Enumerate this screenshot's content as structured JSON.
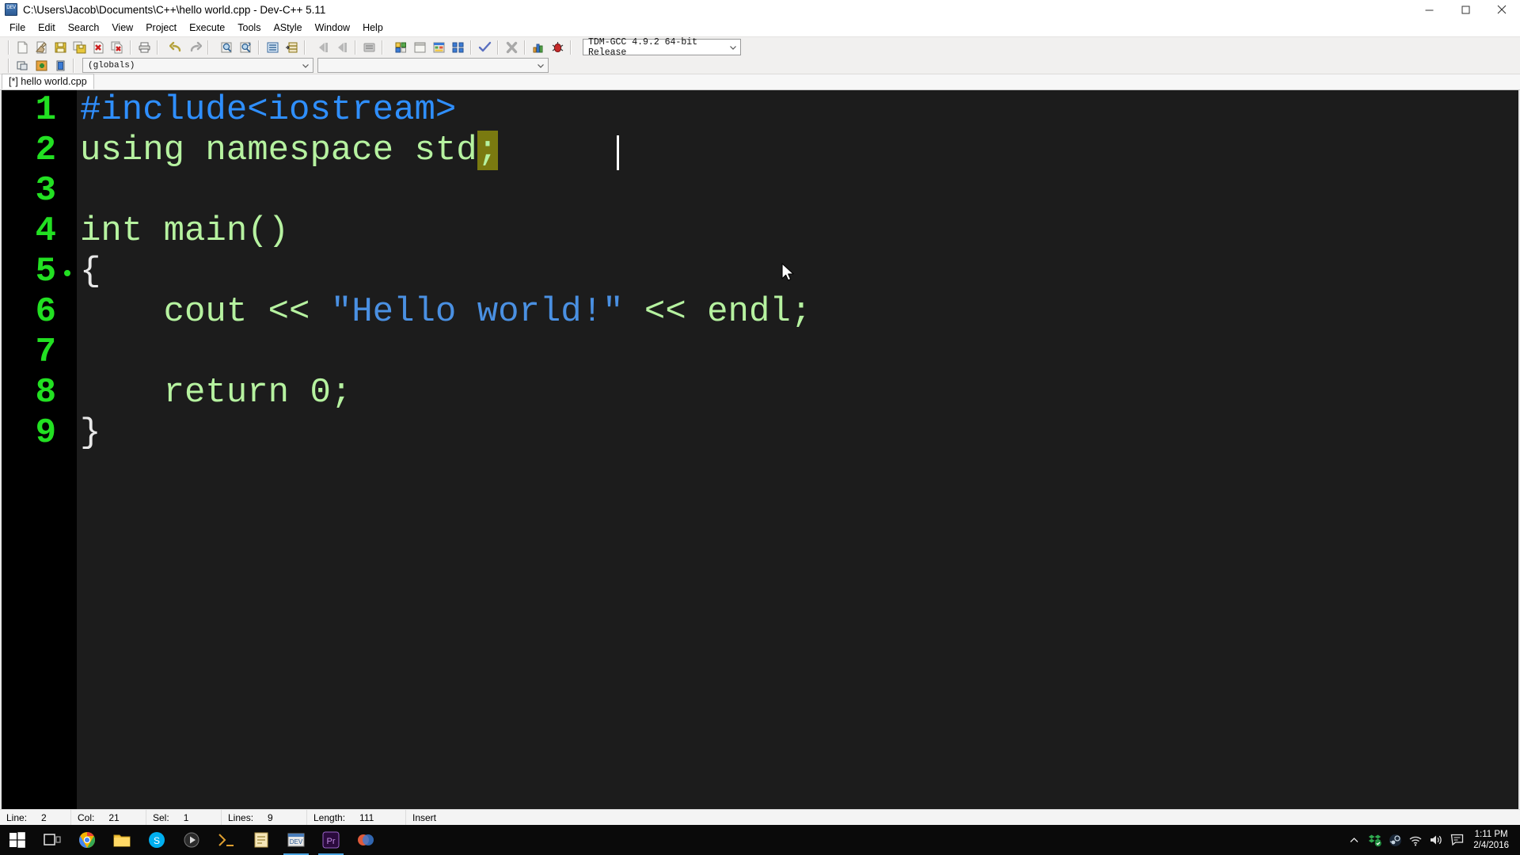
{
  "window": {
    "title": "C:\\Users\\Jacob\\Documents\\C++\\hello world.cpp - Dev-C++ 5.11",
    "app_icon": "dev-cpp-icon",
    "minimize": "—",
    "maximize": "❐",
    "close": "✕"
  },
  "menu": {
    "items": [
      {
        "label": "File"
      },
      {
        "label": "Edit"
      },
      {
        "label": "Search"
      },
      {
        "label": "View"
      },
      {
        "label": "Project"
      },
      {
        "label": "Execute"
      },
      {
        "label": "Tools"
      },
      {
        "label": "AStyle"
      },
      {
        "label": "Window"
      },
      {
        "label": "Help"
      }
    ]
  },
  "toolbar": {
    "groups": [
      {
        "buttons": [
          {
            "name": "new-file-button",
            "icon": "new-file-icon",
            "enabled": true
          },
          {
            "name": "open-file-button",
            "icon": "open-file-icon",
            "enabled": true
          },
          {
            "name": "save-button",
            "icon": "save-icon",
            "enabled": true
          },
          {
            "name": "save-all-button",
            "icon": "save-all-icon",
            "enabled": true
          },
          {
            "name": "close-file-button",
            "icon": "close-file-icon",
            "enabled": true
          },
          {
            "name": "close-all-button",
            "icon": "close-all-icon",
            "enabled": true
          }
        ]
      },
      {
        "buttons": [
          {
            "name": "print-button",
            "icon": "print-icon",
            "enabled": true
          }
        ]
      },
      {
        "buttons": [
          {
            "name": "undo-button",
            "icon": "undo-icon",
            "enabled": true
          },
          {
            "name": "redo-button",
            "icon": "redo-icon",
            "enabled": false
          }
        ]
      },
      {
        "buttons": [
          {
            "name": "find-button",
            "icon": "find-icon",
            "enabled": true
          },
          {
            "name": "replace-button",
            "icon": "replace-icon",
            "enabled": true
          },
          {
            "name": "goto-line-button",
            "icon": "goto-line-icon",
            "enabled": true
          },
          {
            "name": "goto-function-button",
            "icon": "goto-function-icon",
            "enabled": true
          }
        ]
      },
      {
        "buttons": [
          {
            "name": "back-button",
            "icon": "back-arrow-icon",
            "enabled": false
          },
          {
            "name": "forward-button",
            "icon": "forward-arrow-icon",
            "enabled": false
          },
          {
            "name": "toggle-bookmark-button",
            "icon": "bookmark-icon",
            "enabled": false
          }
        ]
      },
      {
        "buttons": [
          {
            "name": "new-project-button",
            "icon": "new-project-icon",
            "enabled": true
          },
          {
            "name": "new-source-file-button",
            "icon": "new-source-icon",
            "enabled": true
          },
          {
            "name": "project-options-button",
            "icon": "project-options-icon",
            "enabled": true
          },
          {
            "name": "compiler-options-button",
            "icon": "compiler-options-icon",
            "enabled": true
          }
        ]
      },
      {
        "buttons": [
          {
            "name": "compile-button",
            "icon": "compile-check-icon",
            "enabled": true
          }
        ]
      },
      {
        "buttons": [
          {
            "name": "abort-compilation-button",
            "icon": "abort-icon",
            "enabled": false
          }
        ]
      },
      {
        "buttons": [
          {
            "name": "profile-analysis-button",
            "icon": "bar-chart-icon",
            "enabled": true
          },
          {
            "name": "debug-button",
            "icon": "debug-bug-icon",
            "enabled": true
          }
        ]
      }
    ],
    "compiler_select": {
      "value": "TDM-GCC 4.9.2 64-bit Release",
      "caret_icon": "chevron-down-icon"
    }
  },
  "toolbar2": {
    "buttons": [
      {
        "name": "project-manager-button",
        "icon": "project-panel-icon"
      },
      {
        "name": "add-to-project-button",
        "icon": "add-green-plus-icon"
      },
      {
        "name": "remove-from-project-button",
        "icon": "remove-book-icon"
      }
    ],
    "scope_select": {
      "value": "(globals)",
      "caret_icon": "chevron-down-icon"
    },
    "member_select": {
      "value": "",
      "caret_icon": "chevron-down-icon"
    }
  },
  "tabs": [
    {
      "label": "[*] hello world.cpp",
      "active": true
    }
  ],
  "editor": {
    "colors": {
      "background": "#1c1c1c",
      "gutter_background": "#000000",
      "line_number": "#22e022",
      "preprocessor": "#2f8fff",
      "string": "#4a90e2",
      "identifier": "#b6f2a0",
      "symbol": "#e8e8e8",
      "selection": "#7a7a10",
      "caret": "#ffffff"
    },
    "lines": [
      {
        "number": "1",
        "segments": [
          {
            "text": "#include<iostream>",
            "kind": "pre"
          }
        ],
        "fold_marker": false
      },
      {
        "number": "2",
        "segments": [
          {
            "text": "using namespace std",
            "kind": "code"
          },
          {
            "text": ";",
            "kind": "sel"
          }
        ],
        "fold_marker": false
      },
      {
        "number": "3",
        "segments": [
          {
            "text": "",
            "kind": "code"
          }
        ],
        "fold_marker": false
      },
      {
        "number": "4",
        "segments": [
          {
            "text": "int main()",
            "kind": "code"
          }
        ],
        "fold_marker": false
      },
      {
        "number": "5",
        "segments": [
          {
            "text": "{",
            "kind": "white"
          }
        ],
        "fold_marker": true
      },
      {
        "number": "6",
        "segments": [
          {
            "text": "    cout << ",
            "kind": "code"
          },
          {
            "text": "\"Hello world!\"",
            "kind": "str"
          },
          {
            "text": " << endl;",
            "kind": "code"
          }
        ],
        "fold_marker": false
      },
      {
        "number": "7",
        "segments": [
          {
            "text": "",
            "kind": "code"
          }
        ],
        "fold_marker": false
      },
      {
        "number": "8",
        "segments": [
          {
            "text": "    return 0;",
            "kind": "code"
          }
        ],
        "fold_marker": false
      },
      {
        "number": "9",
        "segments": [
          {
            "text": "}",
            "kind": "white"
          }
        ],
        "fold_marker": false
      }
    ],
    "mouse_cursor": "arrow-pointer"
  },
  "statusbar": {
    "line_label": "Line:",
    "line_value": "2",
    "col_label": "Col:",
    "col_value": "21",
    "sel_label": "Sel:",
    "sel_value": "1",
    "lines_label": "Lines:",
    "lines_value": "9",
    "length_label": "Length:",
    "length_value": "111",
    "mode": "Insert"
  },
  "taskbar": {
    "start": {
      "name": "start-button",
      "icon": "windows-logo-icon"
    },
    "search": {
      "name": "task-view-button",
      "icon": "task-view-icon"
    },
    "apps": [
      {
        "name": "taskbar-chrome",
        "icon": "chrome-icon",
        "active": false
      },
      {
        "name": "taskbar-file-explorer",
        "icon": "folder-icon",
        "active": false
      },
      {
        "name": "taskbar-skype",
        "icon": "skype-icon",
        "active": false
      },
      {
        "name": "taskbar-media",
        "icon": "media-icon",
        "active": false
      },
      {
        "name": "taskbar-terminal",
        "icon": "terminal-icon",
        "active": false
      },
      {
        "name": "taskbar-notepad",
        "icon": "notepad-icon",
        "active": false
      },
      {
        "name": "taskbar-devcpp",
        "icon": "dev-cpp-icon",
        "active": true
      },
      {
        "name": "taskbar-premiere",
        "icon": "premiere-pr-icon",
        "active": true
      },
      {
        "name": "taskbar-photoshop",
        "icon": "photo-app-icon",
        "active": false
      }
    ],
    "tray": {
      "show_hidden": {
        "name": "show-hidden-icons-button",
        "icon": "chevron-up-icon"
      },
      "icons": [
        {
          "name": "tray-dropbox",
          "icon": "dropbox-icon"
        },
        {
          "name": "tray-steam",
          "icon": "steam-icon"
        },
        {
          "name": "tray-network",
          "icon": "wifi-icon"
        },
        {
          "name": "tray-volume",
          "icon": "speaker-icon"
        },
        {
          "name": "tray-action-center",
          "icon": "action-center-icon"
        }
      ],
      "clock_time": "1:11 PM",
      "clock_date": "2/4/2016"
    }
  }
}
